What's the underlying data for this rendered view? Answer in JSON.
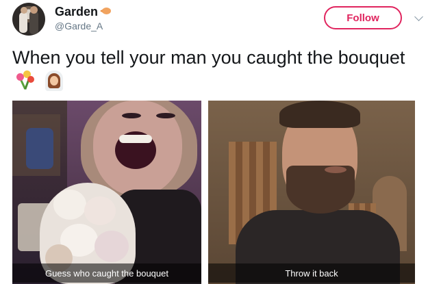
{
  "user": {
    "display_name": "Garden",
    "name_emoji": "fish-emoji-icon",
    "handle": "@Garde_A"
  },
  "actions": {
    "follow_label": "Follow",
    "menu_icon": "chevron-down-icon"
  },
  "tweet": {
    "text": "When you tell your man you caught the bouquet",
    "emojis": [
      "bouquet-emoji-icon",
      "bride-emoji-icon"
    ]
  },
  "media": [
    {
      "caption": "Guess who caught the bouquet"
    },
    {
      "caption": "Throw it back"
    }
  ],
  "colors": {
    "accent": "#e0245e",
    "text": "#14171a",
    "secondary_text": "#657786"
  }
}
